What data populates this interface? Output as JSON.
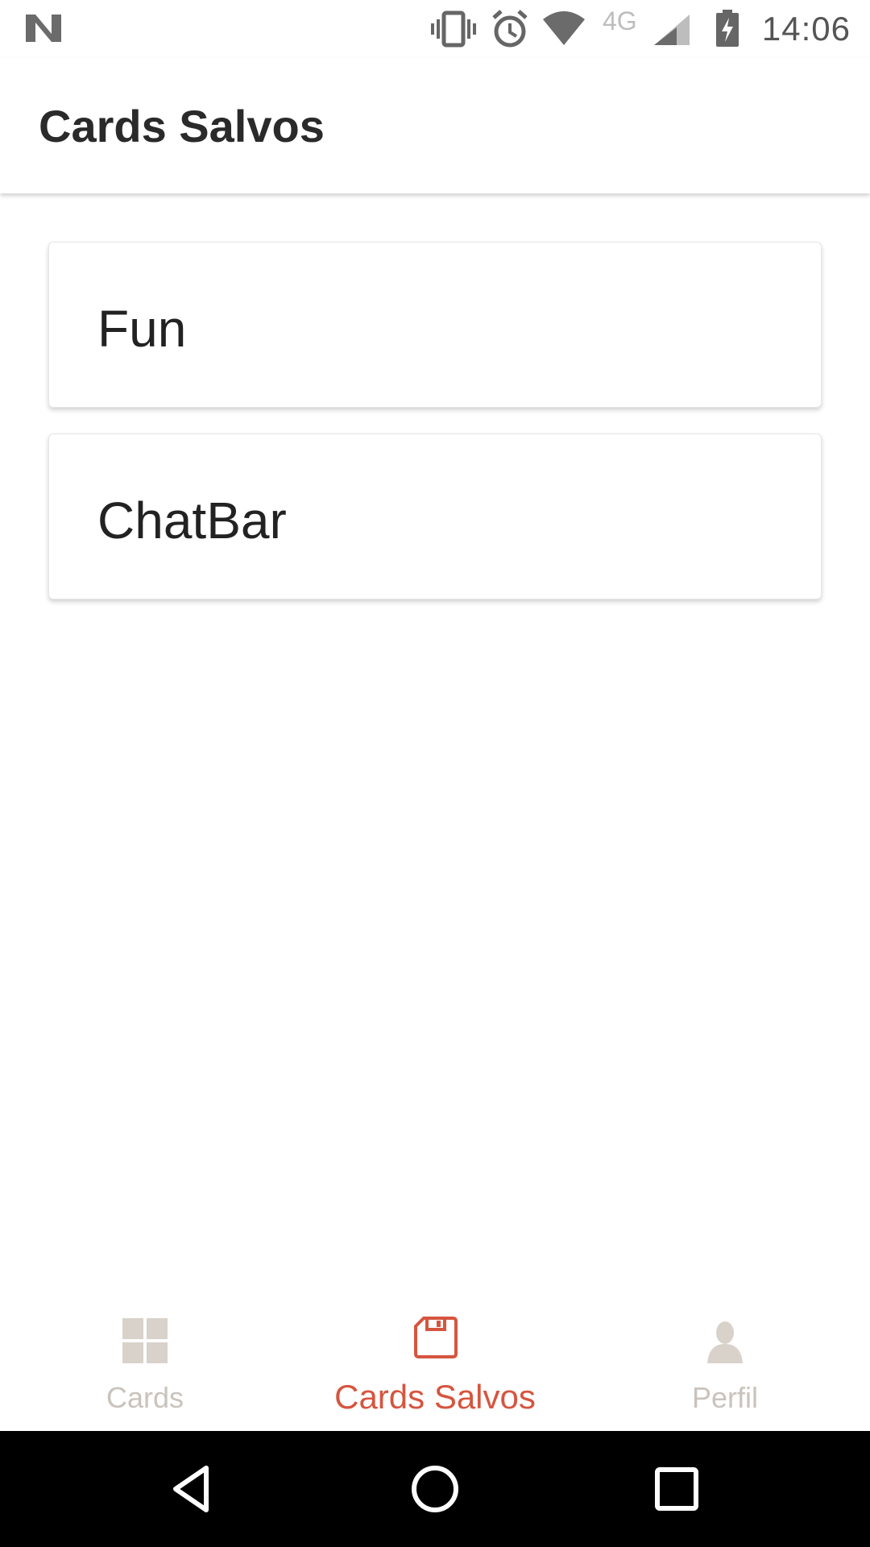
{
  "status_bar": {
    "time": "14:06",
    "network_label": "4G",
    "icons": [
      "n-logo-icon",
      "vibrate-icon",
      "alarm-icon",
      "wifi-icon",
      "cell-signal-icon",
      "battery-charging-icon"
    ]
  },
  "app_bar": {
    "title": "Cards Salvos"
  },
  "cards": [
    {
      "title": "Fun"
    },
    {
      "title": "ChatBar"
    }
  ],
  "bottom_nav": {
    "items": [
      {
        "label": "Cards",
        "icon": "grid-icon",
        "active": false
      },
      {
        "label": "Cards Salvos",
        "icon": "save-icon",
        "active": true
      },
      {
        "label": "Perfil",
        "icon": "person-icon",
        "active": false
      }
    ]
  },
  "system_nav": {
    "buttons": [
      "back-icon",
      "home-icon",
      "recents-icon"
    ]
  },
  "colors": {
    "accent": "#d6553f",
    "inactive": "#c9c3bc",
    "text": "#222222"
  }
}
